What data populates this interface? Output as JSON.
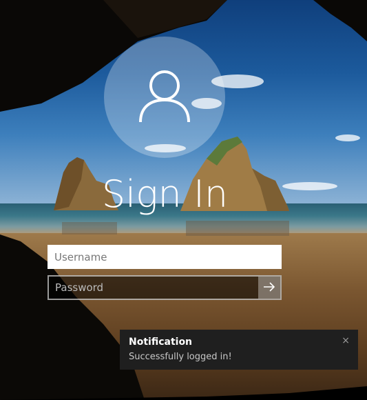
{
  "signin": {
    "title": "Sign In",
    "username_placeholder": "Username",
    "password_placeholder": "Password",
    "submit_icon": "arrow-right-icon",
    "avatar_icon": "user-icon"
  },
  "notification": {
    "title": "Notification",
    "message": "Successfully logged in!",
    "close_label": "×"
  },
  "colors": {
    "toast_bg": "#1f1f1f",
    "input_bg": "#ffffff"
  }
}
